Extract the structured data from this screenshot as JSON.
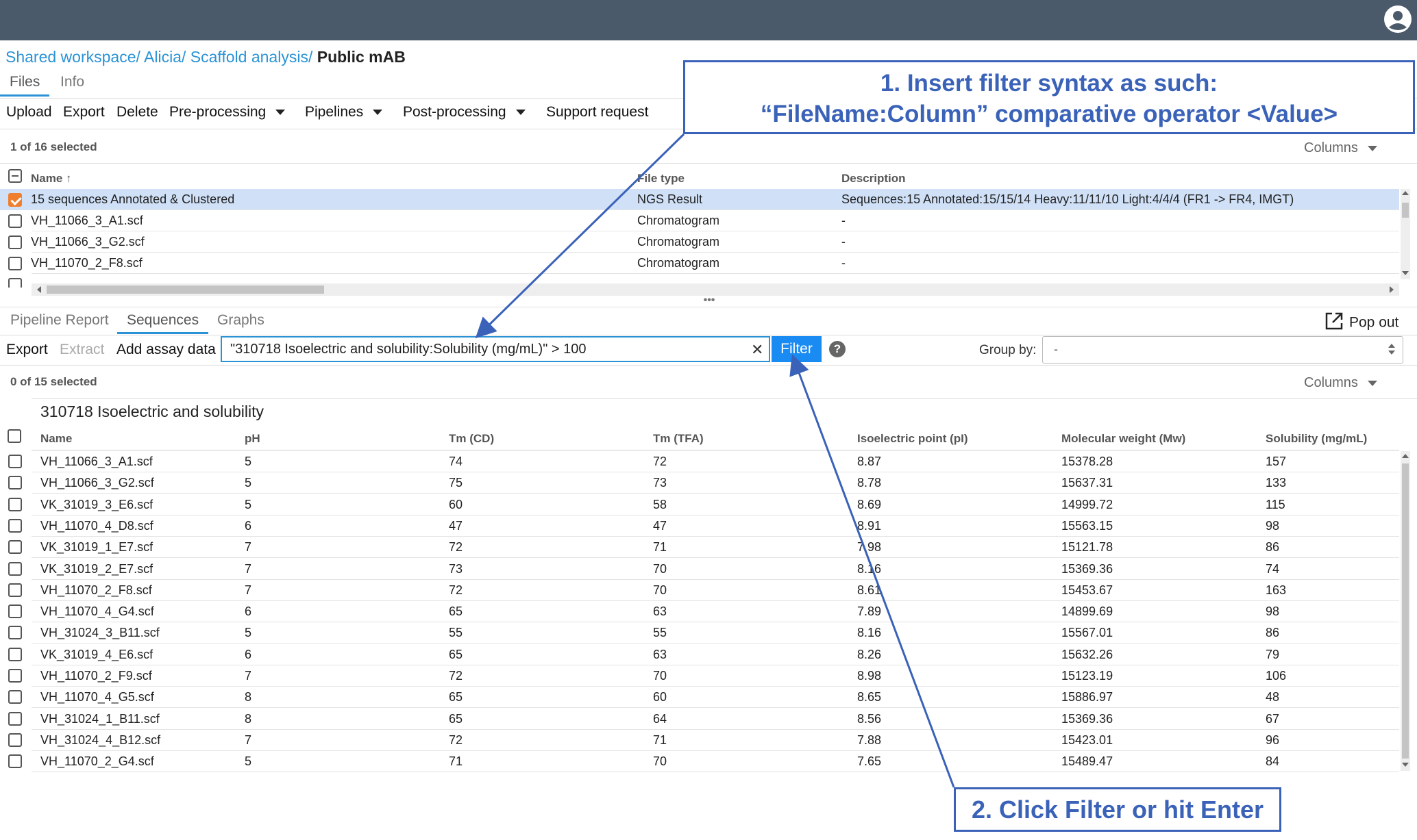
{
  "breadcrumb": {
    "parts": [
      "Shared workspace/",
      "Alicia/",
      "Scaffold analysis/"
    ],
    "current": "Public mAB"
  },
  "top_tabs": [
    "Files",
    "Info"
  ],
  "toolbar": {
    "upload": "Upload",
    "export": "Export",
    "delete": "Delete",
    "preprocessing": "Pre-processing",
    "pipelines": "Pipelines",
    "postprocessing": "Post-processing",
    "support": "Support request"
  },
  "files": {
    "selected_count": "1 of 16 selected",
    "columns_label": "Columns",
    "headers": {
      "name": "Name",
      "file_type": "File type",
      "description": "Description"
    },
    "rows": [
      {
        "name": "15 sequences Annotated & Clustered",
        "type": "NGS Result",
        "description": "Sequences:15 Annotated:15/15/14 Heavy:11/11/10 Light:4/4/4 (FR1 -> FR4, IMGT)",
        "checked": true
      },
      {
        "name": "VH_11066_3_A1.scf",
        "type": "Chromatogram",
        "description": "-",
        "checked": false
      },
      {
        "name": "VH_11066_3_G2.scf",
        "type": "Chromatogram",
        "description": "-",
        "checked": false
      },
      {
        "name": "VH_11070_2_F8.scf",
        "type": "Chromatogram",
        "description": "-",
        "checked": false
      }
    ]
  },
  "bottom_tabs": [
    "Pipeline Report",
    "Sequences",
    "Graphs"
  ],
  "pop_out": "Pop out",
  "seq_toolbar": {
    "export": "Export",
    "extract": "Extract",
    "add_assay": "Add assay data"
  },
  "filter": {
    "value": "\"310718 Isoelectric and solubility:Solubility (mg/mL)\" > 100",
    "button": "Filter",
    "help": "?"
  },
  "group_by": {
    "label": "Group by:",
    "value": "-"
  },
  "sequences": {
    "selected_count": "0 of 15 selected",
    "columns_label": "Columns",
    "section_title": "310718 Isoelectric and solubility",
    "headers": [
      "Name",
      "pH",
      "Tm (CD)",
      "Tm (TFA)",
      "Isoelectric point (pI)",
      "Molecular weight (Mw)",
      "Solubility (mg/mL)"
    ],
    "rows": [
      [
        "VH_11066_3_A1.scf",
        "5",
        "74",
        "72",
        "8.87",
        "15378.28",
        "157"
      ],
      [
        "VH_11066_3_G2.scf",
        "5",
        "75",
        "73",
        "8.78",
        "15637.31",
        "133"
      ],
      [
        "VK_31019_3_E6.scf",
        "5",
        "60",
        "58",
        "8.69",
        "14999.72",
        "115"
      ],
      [
        "VH_11070_4_D8.scf",
        "6",
        "47",
        "47",
        "8.91",
        "15563.15",
        "98"
      ],
      [
        "VK_31019_1_E7.scf",
        "7",
        "72",
        "71",
        "7.98",
        "15121.78",
        "86"
      ],
      [
        "VK_31019_2_E7.scf",
        "7",
        "73",
        "70",
        "8.16",
        "15369.36",
        "74"
      ],
      [
        "VH_11070_2_F8.scf",
        "7",
        "72",
        "70",
        "8.61",
        "15453.67",
        "163"
      ],
      [
        "VH_11070_4_G4.scf",
        "6",
        "65",
        "63",
        "7.89",
        "14899.69",
        "98"
      ],
      [
        "VH_31024_3_B11.scf",
        "5",
        "55",
        "55",
        "8.16",
        "15567.01",
        "86"
      ],
      [
        "VK_31019_4_E6.scf",
        "6",
        "65",
        "63",
        "8.26",
        "15632.26",
        "79"
      ],
      [
        "VH_11070_2_F9.scf",
        "7",
        "72",
        "70",
        "8.98",
        "15123.19",
        "106"
      ],
      [
        "VH_11070_4_G5.scf",
        "8",
        "65",
        "60",
        "8.65",
        "15886.97",
        "48"
      ],
      [
        "VH_31024_1_B11.scf",
        "8",
        "65",
        "64",
        "8.56",
        "15369.36",
        "67"
      ],
      [
        "VH_31024_4_B12.scf",
        "7",
        "72",
        "71",
        "7.88",
        "15423.01",
        "96"
      ],
      [
        "VH_11070_2_G4.scf",
        "5",
        "71",
        "70",
        "7.65",
        "15489.47",
        "84"
      ]
    ]
  },
  "callouts": {
    "step1_line1": "1. Insert filter syntax as such:",
    "step1_line2": "“FileName:Column” comparative operator <Value>",
    "step2": "2. Click Filter or hit Enter"
  },
  "colors": {
    "topbar": "#4b5a6b",
    "link": "#2a93d5",
    "filter_button": "#1a8bf2",
    "checkbox_checked": "#ef7f2e",
    "selected_row": "#cfe0f7",
    "callout": "#3a62b8"
  }
}
